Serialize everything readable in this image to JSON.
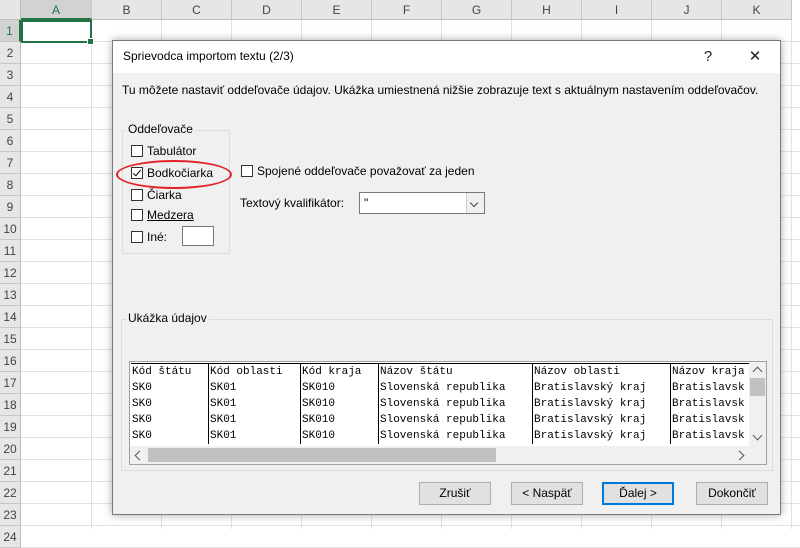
{
  "spreadsheet": {
    "columns": [
      "A",
      "B",
      "C",
      "D",
      "E",
      "F",
      "G",
      "H",
      "I",
      "J",
      "K"
    ],
    "rows": [
      "1",
      "2",
      "3",
      "4",
      "5",
      "6",
      "7",
      "8",
      "9",
      "10",
      "11",
      "12",
      "13",
      "14",
      "15",
      "16",
      "17",
      "18",
      "19",
      "20",
      "21",
      "22",
      "23",
      "24"
    ],
    "selected_column": "A",
    "selected_row": "1"
  },
  "dialog": {
    "title": "Sprievodca importom textu (2/3)",
    "help_icon": "?",
    "close_icon": "✕",
    "description": "Tu môžete nastaviť oddeľovače údajov. Ukážka umiestnená nižšie zobrazuje text s aktuálnym nastavením oddeľovačov.",
    "delimiters": {
      "label": "Oddeľovače",
      "options": [
        {
          "label": "Tabulátor",
          "checked": false
        },
        {
          "label": "Bodkočiarka",
          "checked": true
        },
        {
          "label": "Čiarka",
          "checked": false
        },
        {
          "label": "Medzera",
          "checked": false
        },
        {
          "label": "Iné:",
          "checked": false
        }
      ],
      "other_value": ""
    },
    "consecutive": {
      "label": "Spojené oddeľovače považovať za jeden",
      "checked": false
    },
    "qualifier": {
      "label": "Textový kvalifikátor:",
      "value": "\""
    },
    "preview": {
      "label": "Ukážka údajov",
      "rows": [
        [
          "Kód štátu",
          "Kód oblasti",
          "Kód kraja",
          "Názov štátu",
          "Názov oblasti",
          "Názov kraja"
        ],
        [
          "SK0",
          "SK01",
          "SK010",
          "Slovenská republika",
          "Bratislavský kraj",
          "Bratislavsk"
        ],
        [
          "SK0",
          "SK01",
          "SK010",
          "Slovenská republika",
          "Bratislavský kraj",
          "Bratislavsk"
        ],
        [
          "SK0",
          "SK01",
          "SK010",
          "Slovenská republika",
          "Bratislavský kraj",
          "Bratislavsk"
        ],
        [
          "SK0",
          "SK01",
          "SK010",
          "Slovenská republika",
          "Bratislavský kraj",
          "Bratislavsk"
        ]
      ]
    },
    "buttons": {
      "cancel": "Zrušiť",
      "back": "< Naspäť",
      "next": "Ďalej >",
      "finish": "Dokončiť"
    }
  },
  "colors": {
    "excel_green": "#217346",
    "highlight_red": "#e2232a",
    "focus_blue": "#0078d7"
  }
}
